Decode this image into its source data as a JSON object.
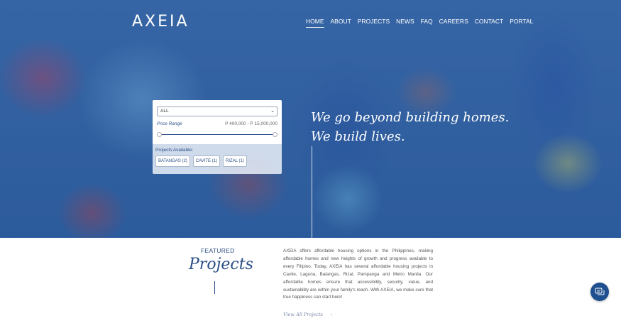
{
  "brand": {
    "logo_text": "AXEIA"
  },
  "nav": {
    "items": [
      "HOME",
      "ABOUT",
      "PROJECTS",
      "NEWS",
      "FAQ",
      "CAREERS",
      "CONTACT",
      "PORTAL"
    ],
    "active": "HOME"
  },
  "filter": {
    "location_select": "ALL",
    "price_label": "Price Range",
    "price_value": "P 400,000 - P 15,000,000",
    "available_label": "Projects Available:",
    "chips": [
      "BATANGAS (2)",
      "CAVITE (1)",
      "RIZAL (1)"
    ]
  },
  "hero": {
    "tagline_line1": "We go beyond building homes.",
    "tagline_line2": "We build lives."
  },
  "featured": {
    "label": "FEATURED",
    "title": "Projects",
    "description": "AXEIA offers affordable housing options in the Philippines, making affordable homes and new heights of growth and progress available to every Filipino. Today, AXEIA has several affordable housing projects in Cavite, Laguna, Batangas, Rizal, Pampanga and Metro Manila. Our affordable homes ensure that accessibility, security, value, and sustainability are within your family's reach. With AXEIA, we make sure that true happiness can start here!",
    "view_all": "View All Projects",
    "view_all_arrow": "›"
  },
  "colors": {
    "brand_blue": "#2b4f86",
    "hero_overlay": "#3a69a8",
    "chat_button": "#1f4f8f"
  },
  "icons": {
    "chat": "chat-bubble-icon",
    "select_chevron": "chevron-down-icon"
  }
}
